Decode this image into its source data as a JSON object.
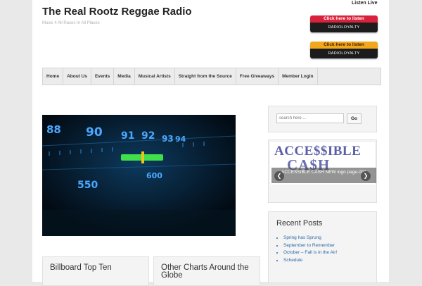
{
  "header": {
    "site_title": "The Real Rootz Reggae Radio",
    "tagline": "Music 4 All Races In All Places",
    "listen_live": "Listen Live",
    "listen_buttons": [
      {
        "label": "Click here to listen",
        "logo": "RADIOLOYALTY"
      },
      {
        "label": "Click here to listen",
        "logo": "RADIOLOYALTY"
      }
    ]
  },
  "nav": {
    "items": [
      "Home",
      "About Us",
      "Events",
      "Media",
      "Musical Artists",
      "Straight from the Source",
      "Free Giveaways",
      "Member Login"
    ]
  },
  "hero": {
    "dial_numbers": [
      "88",
      "90",
      "91",
      "92",
      "93",
      "94",
      "600",
      "550"
    ]
  },
  "sidebar": {
    "search": {
      "placeholder": "search here ...",
      "button": "Go"
    },
    "ad": {
      "line1": "ACCE$$IBLE",
      "line2": "CA$H",
      "caption": "ACCESSIBLE CASH NEW logo page-001"
    },
    "recent_posts": {
      "title": "Recent Posts",
      "items": [
        "Spring has Sprung",
        "September to Remember",
        "October – Fall is in the Air!",
        "Schedule"
      ]
    }
  },
  "widgets": {
    "billboard_title": "Billboard Top Ten",
    "other_charts_title": "Other Charts Around the Globe"
  }
}
